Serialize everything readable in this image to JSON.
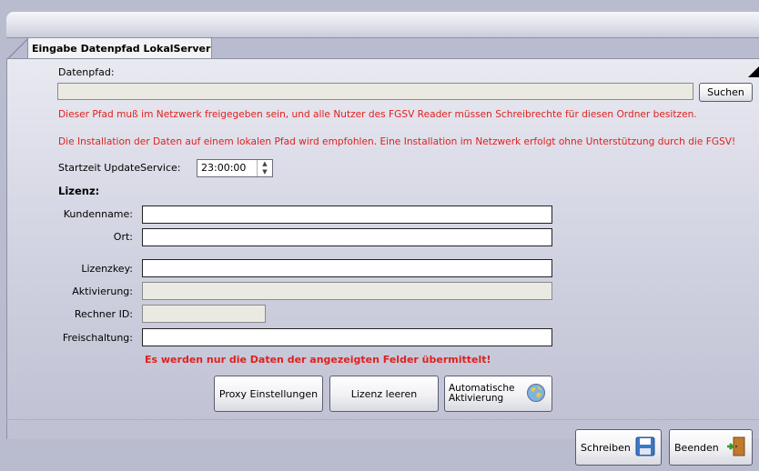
{
  "tab": {
    "title": "Eingabe Datenpfad LokalServer"
  },
  "datenpfad": {
    "label": "Datenpfad:",
    "value": "",
    "search_button": "Suchen",
    "warning1": "Dieser Pfad muß im Netzwerk freigegeben sein, und alle Nutzer des FGSV Reader müssen Schreibrechte für diesen Ordner besitzen.",
    "warning2": "Die Installation der Daten auf einem lokalen Pfad wird empfohlen. Eine Installation im Netzwerk erfolgt ohne Unterstützung durch die FGSV!"
  },
  "update_service": {
    "label": "Startzeit UpdateService:",
    "value": "23:00:00"
  },
  "lizenz": {
    "heading": "Lizenz:",
    "kundenname_label": "Kundenname:",
    "ort_label": "Ort:",
    "lizenzkey_label": "Lizenzkey:",
    "aktivierung_label": "Aktivierung:",
    "rechner_id_label": "Rechner ID:",
    "freischaltung_label": "Freischaltung:",
    "notice": "Es werden nur die Daten der angezeigten Felder übermittelt!"
  },
  "buttons": {
    "proxy": "Proxy Einstellungen",
    "clear": "Lizenz leeren",
    "auto_activation_line1": "Automatische",
    "auto_activation_line2": "Aktivierung",
    "write": "Schreiben",
    "exit": "Beenden"
  },
  "icons": {
    "auto_activation": "globe-icon",
    "write": "floppy-disk-icon",
    "exit": "exit-door-icon"
  },
  "colors": {
    "warning": "#e0201e",
    "accent": "#3a78c8"
  }
}
